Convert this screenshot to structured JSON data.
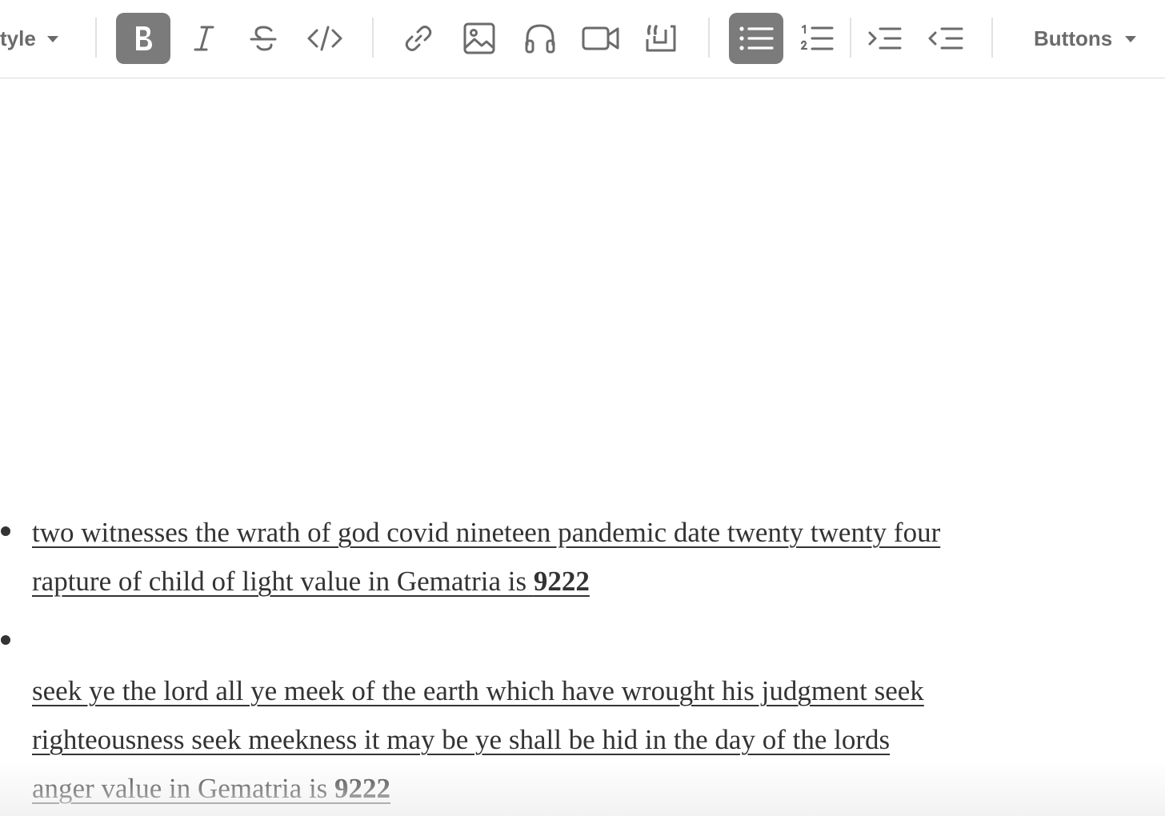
{
  "toolbar": {
    "style_label": "tyle",
    "buttons_label": "Buttons",
    "tools": [
      {
        "icon": "bold-icon",
        "active": true
      },
      {
        "icon": "italic-icon",
        "active": false
      },
      {
        "icon": "strikethrough-icon",
        "active": false
      },
      {
        "icon": "code-icon",
        "active": false
      },
      {
        "icon": "link-icon",
        "active": false
      },
      {
        "icon": "image-icon",
        "active": false
      },
      {
        "icon": "headphones-icon",
        "active": false
      },
      {
        "icon": "video-icon",
        "active": false
      },
      {
        "icon": "quote-icon",
        "active": false
      },
      {
        "icon": "bullet-list-icon",
        "active": true
      },
      {
        "icon": "numbered-list-icon",
        "active": false
      },
      {
        "icon": "indent-icon",
        "active": false
      },
      {
        "icon": "outdent-icon",
        "active": false
      }
    ]
  },
  "colors": {
    "active_button": "#7b7b7b",
    "icon": "#6b6b6b",
    "text": "#333333"
  },
  "content": {
    "items": [
      {
        "lines": [
          "two witnesses the wrath of god covid nineteen pandemic date twenty twenty four ",
          "rapture of child of light value in Gematria is "
        ],
        "value": "9222"
      },
      {
        "lines": [
          "seek ye the lord all ye meek of the earth which have wrought his judgment seek ",
          "righteousness seek meekness it may be ye shall be hid in the day of the lords ",
          "anger value in Gematria is "
        ],
        "value": "9222"
      }
    ]
  }
}
